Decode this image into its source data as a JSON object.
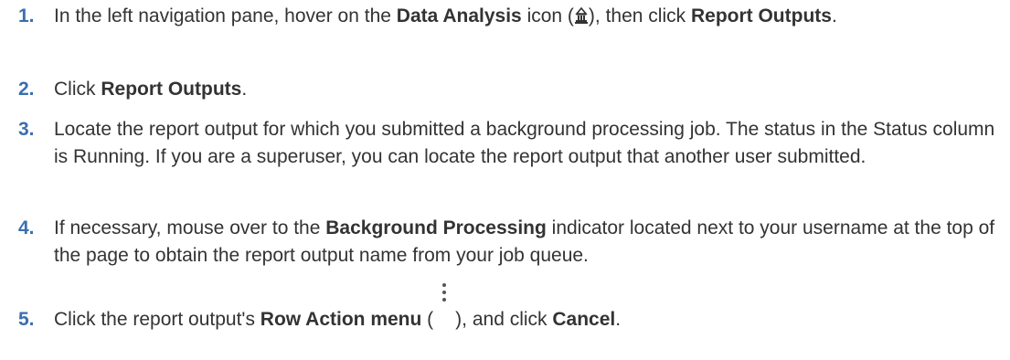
{
  "steps": [
    {
      "number": "1.",
      "parts": {
        "a": "In the left navigation pane, hover on the ",
        "b": "Data Analysis",
        "c": " icon (",
        "d": "), then click ",
        "e": "Report Outputs",
        "f": "."
      },
      "icon": "data-analysis-icon"
    },
    {
      "number": "2.",
      "parts": {
        "a": "Click ",
        "b": "Report Outputs",
        "c": "."
      }
    },
    {
      "number": "3.",
      "text": "Locate the report output for which you submitted a background processing job. The status in the Status column is Running. If you are a superuser, you can locate the report output that another user submitted."
    },
    {
      "number": "4.",
      "parts": {
        "a": "If necessary, mouse over to the ",
        "b": "Background Processing",
        "c": " indicator located next to your username at the top of the page to obtain the report output name from your job queue."
      }
    },
    {
      "number": "5.",
      "parts": {
        "a": "Click the report output's ",
        "b": "Row Action menu",
        "c": " (",
        "d": "), and click ",
        "e": "Cancel",
        "f": "."
      },
      "icon": "row-action-menu-icon"
    }
  ],
  "colors": {
    "number": "#3a6fb0",
    "text": "#333333"
  }
}
